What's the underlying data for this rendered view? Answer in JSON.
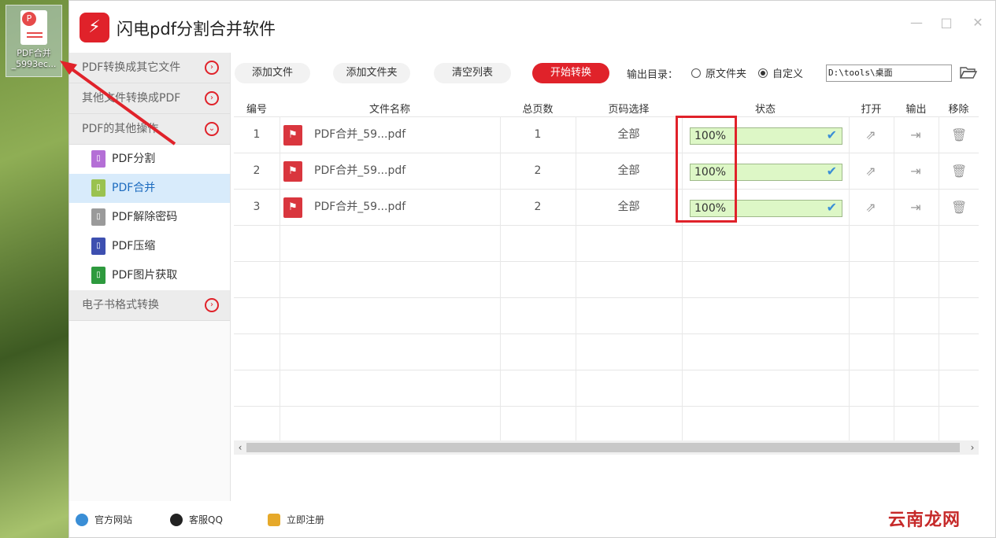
{
  "desktop": {
    "icon_label_1": "PDF合并",
    "icon_label_2": "_5993ec..."
  },
  "window": {
    "title": "闪电pdf分割合并软件",
    "logo_glyph": "⚡"
  },
  "sidebar": {
    "categories": [
      {
        "label": "PDF转换成其它文件"
      },
      {
        "label": "其他文件转换成PDF"
      },
      {
        "label": "PDF的其他操作"
      },
      {
        "label": "电子书格式转换"
      }
    ],
    "items": [
      {
        "label": "PDF分割",
        "color": "#b46fd6"
      },
      {
        "label": "PDF合并",
        "color": "#9ac24f"
      },
      {
        "label": "PDF解除密码",
        "color": "#9a9a9a"
      },
      {
        "label": "PDF压缩",
        "color": "#3d4fb0"
      },
      {
        "label": "PDF图片获取",
        "color": "#2e9a3e"
      }
    ]
  },
  "toolbar": {
    "add_file": "添加文件",
    "add_folder": "添加文件夹",
    "clear_list": "清空列表",
    "start": "开始转换",
    "output_label": "输出目录：",
    "radio_original": "原文件夹",
    "radio_custom": "自定义",
    "output_path": "D:\\tools\\桌面"
  },
  "table": {
    "headers": {
      "num": "编号",
      "name": "文件名称",
      "pages": "总页数",
      "range": "页码选择",
      "status": "状态",
      "open": "打开",
      "output": "输出",
      "remove": "移除"
    },
    "rows": [
      {
        "num": "1",
        "name": "PDF合并_59...pdf",
        "pages": "1",
        "range": "全部",
        "status": "100%",
        "progress": 1.0
      },
      {
        "num": "2",
        "name": "PDF合并_59...pdf",
        "pages": "2",
        "range": "全部",
        "status": "100%",
        "progress": 1.0
      },
      {
        "num": "3",
        "name": "PDF合并_59...pdf",
        "pages": "2",
        "range": "全部",
        "status": "100%",
        "progress": 1.0
      }
    ]
  },
  "footer": {
    "website": "官方网站",
    "qq": "客服QQ",
    "register": "立即注册"
  },
  "watermark": {
    "text": "云南龙网"
  },
  "colors": {
    "accent": "#e0222a",
    "active_bg": "#d8ebfb",
    "progress_bg": "#ddf7c6",
    "check": "#3a8ed6"
  }
}
